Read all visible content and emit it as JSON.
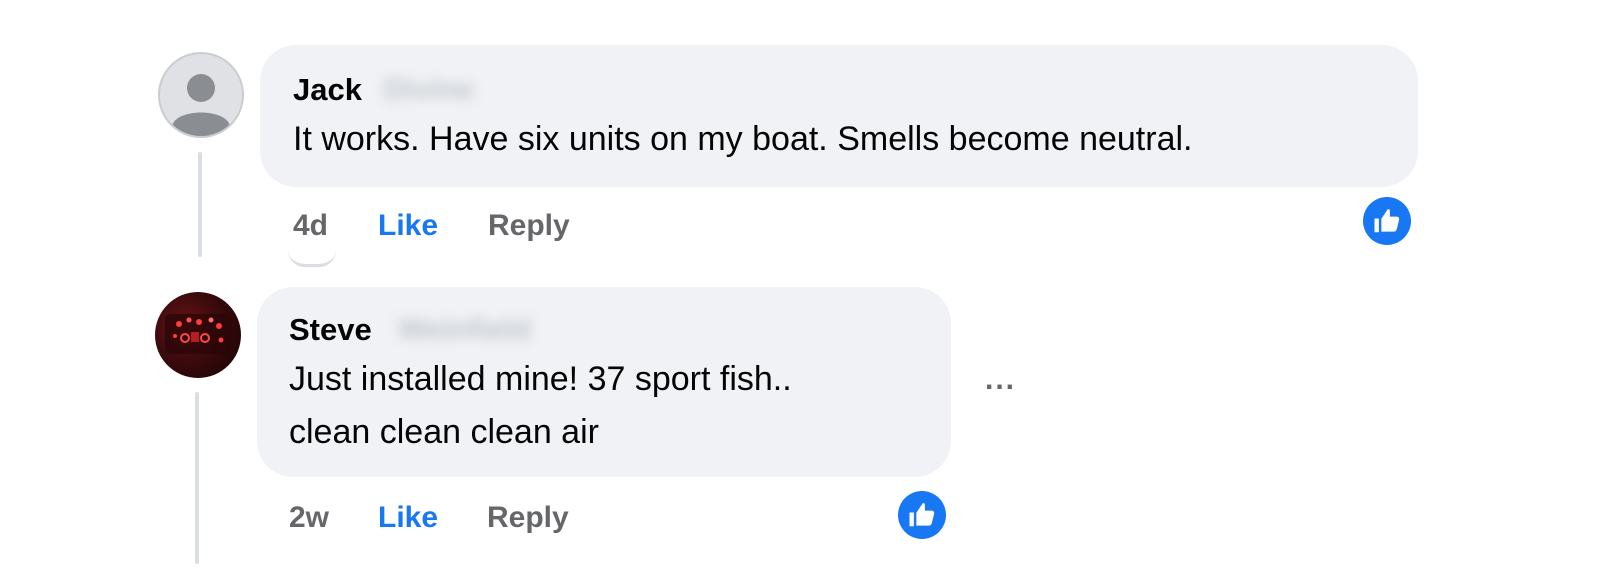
{
  "comments": [
    {
      "author_first": "Jack",
      "author_last": "Divine",
      "text_lines": [
        "It works. Have six units on my boat. Smells become neutral."
      ],
      "time": "4d",
      "like_label": "Like",
      "reply_label": "Reply",
      "avatar": "default-person-icon",
      "reaction": "thumbs-up"
    },
    {
      "author_first": "Steve",
      "author_last": "Weinfield",
      "text_lines": [
        "Just installed mine! 37 sport fish..",
        "clean clean clean air"
      ],
      "time": "2w",
      "like_label": "Like",
      "reply_label": "Reply",
      "avatar": "photo-dashboard-lights",
      "reaction": "thumbs-up",
      "more_options": "..."
    }
  ],
  "colors": {
    "bubble": "#f0f2f5",
    "like_blue": "#1877f2",
    "meta_gray": "#65676b",
    "thread_line": "#dadde1"
  }
}
